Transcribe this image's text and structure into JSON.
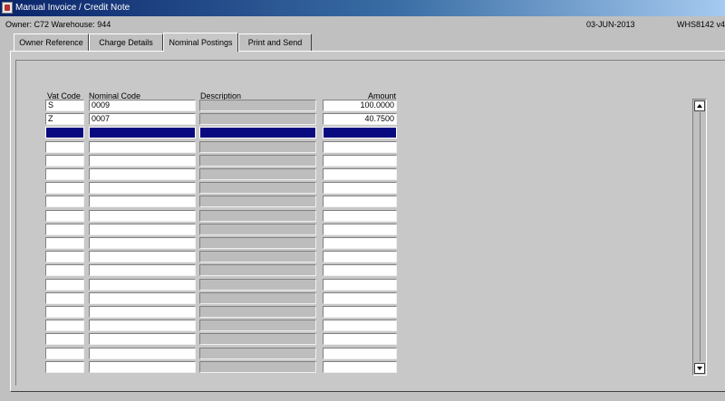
{
  "window": {
    "title": "Manual Invoice / Credit Note"
  },
  "info": {
    "owner": "Owner:  C72    Warehouse:  944",
    "date": "03-JUN-2013",
    "screen": "WHS8142  v4"
  },
  "tabs": [
    {
      "label": "Owner Reference"
    },
    {
      "label": "Charge Details"
    },
    {
      "label": "Nominal Postings",
      "active": true
    },
    {
      "label": "Print and Send"
    }
  ],
  "columns": {
    "vat_code": "Vat Code",
    "nominal_code": "Nominal Code",
    "description": "Description",
    "amount": "Amount"
  },
  "rows": [
    {
      "vat": "S",
      "nominal": "0009",
      "desc": "",
      "amount": "100.0000"
    },
    {
      "vat": "Z",
      "nominal": "0007",
      "desc": "",
      "amount": "40.7500"
    },
    {
      "vat": "",
      "nominal": "",
      "desc": "",
      "amount": "",
      "selected": true
    },
    {
      "vat": "",
      "nominal": "",
      "desc": "",
      "amount": ""
    },
    {
      "vat": "",
      "nominal": "",
      "desc": "",
      "amount": ""
    },
    {
      "vat": "",
      "nominal": "",
      "desc": "",
      "amount": ""
    },
    {
      "vat": "",
      "nominal": "",
      "desc": "",
      "amount": ""
    },
    {
      "vat": "",
      "nominal": "",
      "desc": "",
      "amount": ""
    },
    {
      "vat": "",
      "nominal": "",
      "desc": "",
      "amount": ""
    },
    {
      "vat": "",
      "nominal": "",
      "desc": "",
      "amount": ""
    },
    {
      "vat": "",
      "nominal": "",
      "desc": "",
      "amount": ""
    },
    {
      "vat": "",
      "nominal": "",
      "desc": "",
      "amount": ""
    },
    {
      "vat": "",
      "nominal": "",
      "desc": "",
      "amount": ""
    },
    {
      "vat": "",
      "nominal": "",
      "desc": "",
      "amount": ""
    },
    {
      "vat": "",
      "nominal": "",
      "desc": "",
      "amount": ""
    },
    {
      "vat": "",
      "nominal": "",
      "desc": "",
      "amount": ""
    },
    {
      "vat": "",
      "nominal": "",
      "desc": "",
      "amount": ""
    },
    {
      "vat": "",
      "nominal": "",
      "desc": "",
      "amount": ""
    },
    {
      "vat": "",
      "nominal": "",
      "desc": "",
      "amount": ""
    },
    {
      "vat": "",
      "nominal": "",
      "desc": "",
      "amount": ""
    }
  ],
  "icons": {
    "app": "app-icon",
    "scroll_up": "scroll-up-arrow-icon",
    "scroll_down": "scroll-down-arrow-icon"
  },
  "colors": {
    "titlebar": "#0a246a",
    "selected_row": "#0a0a80",
    "background": "#c0c0c0"
  }
}
